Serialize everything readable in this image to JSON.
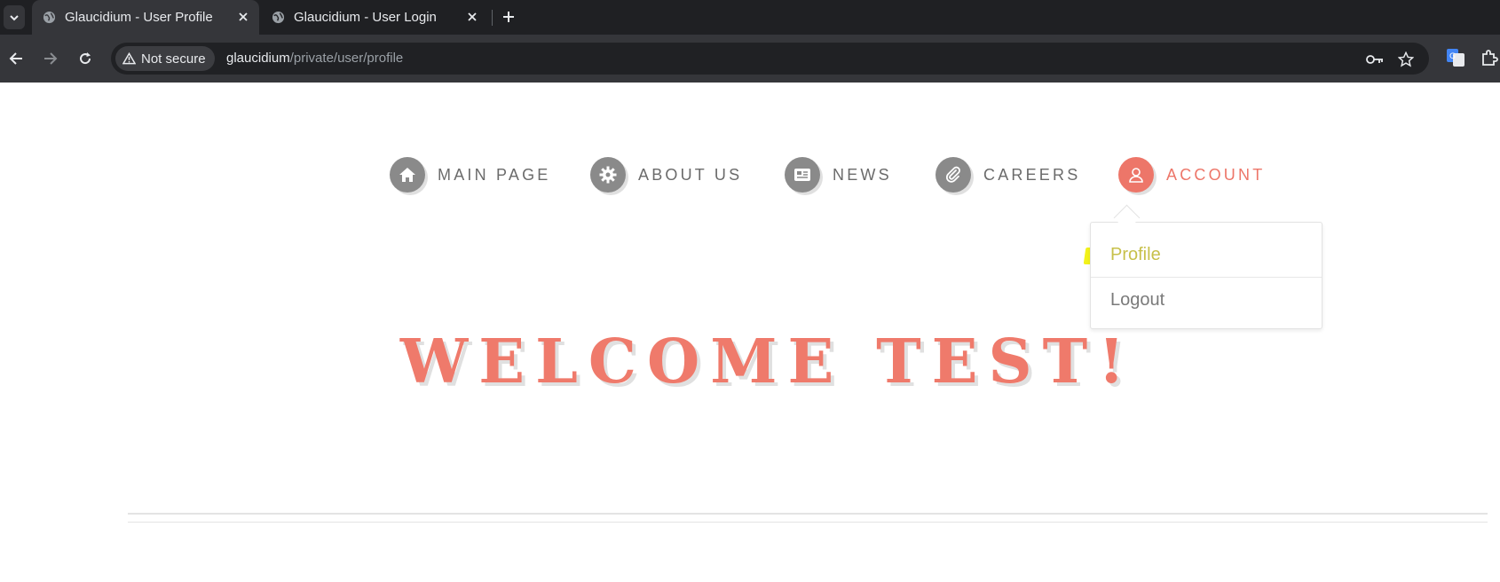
{
  "browser": {
    "tabs": [
      {
        "title": "Glaucidium - User Profile",
        "active": true
      },
      {
        "title": "Glaucidium - User Login",
        "active": false
      }
    ],
    "security_label": "Not secure",
    "url_host": "glaucidium",
    "url_path": "/private/user/profile"
  },
  "nav": {
    "items": [
      {
        "label": "MAIN PAGE",
        "icon": "home-icon"
      },
      {
        "label": "ABOUT US",
        "icon": "gear-icon"
      },
      {
        "label": "NEWS",
        "icon": "newspaper-icon"
      },
      {
        "label": "CAREERS",
        "icon": "paperclip-icon"
      },
      {
        "label": "ACCOUNT",
        "icon": "user-icon",
        "active": true
      }
    ]
  },
  "dropdown": {
    "items": [
      {
        "label": "Profile"
      },
      {
        "label": "Logout"
      }
    ]
  },
  "main": {
    "welcome": "WELCOME TEST!"
  },
  "colors": {
    "accent": "#ed7669",
    "nav_gray": "#8a8a8a",
    "highlight": "#f3f31a"
  }
}
